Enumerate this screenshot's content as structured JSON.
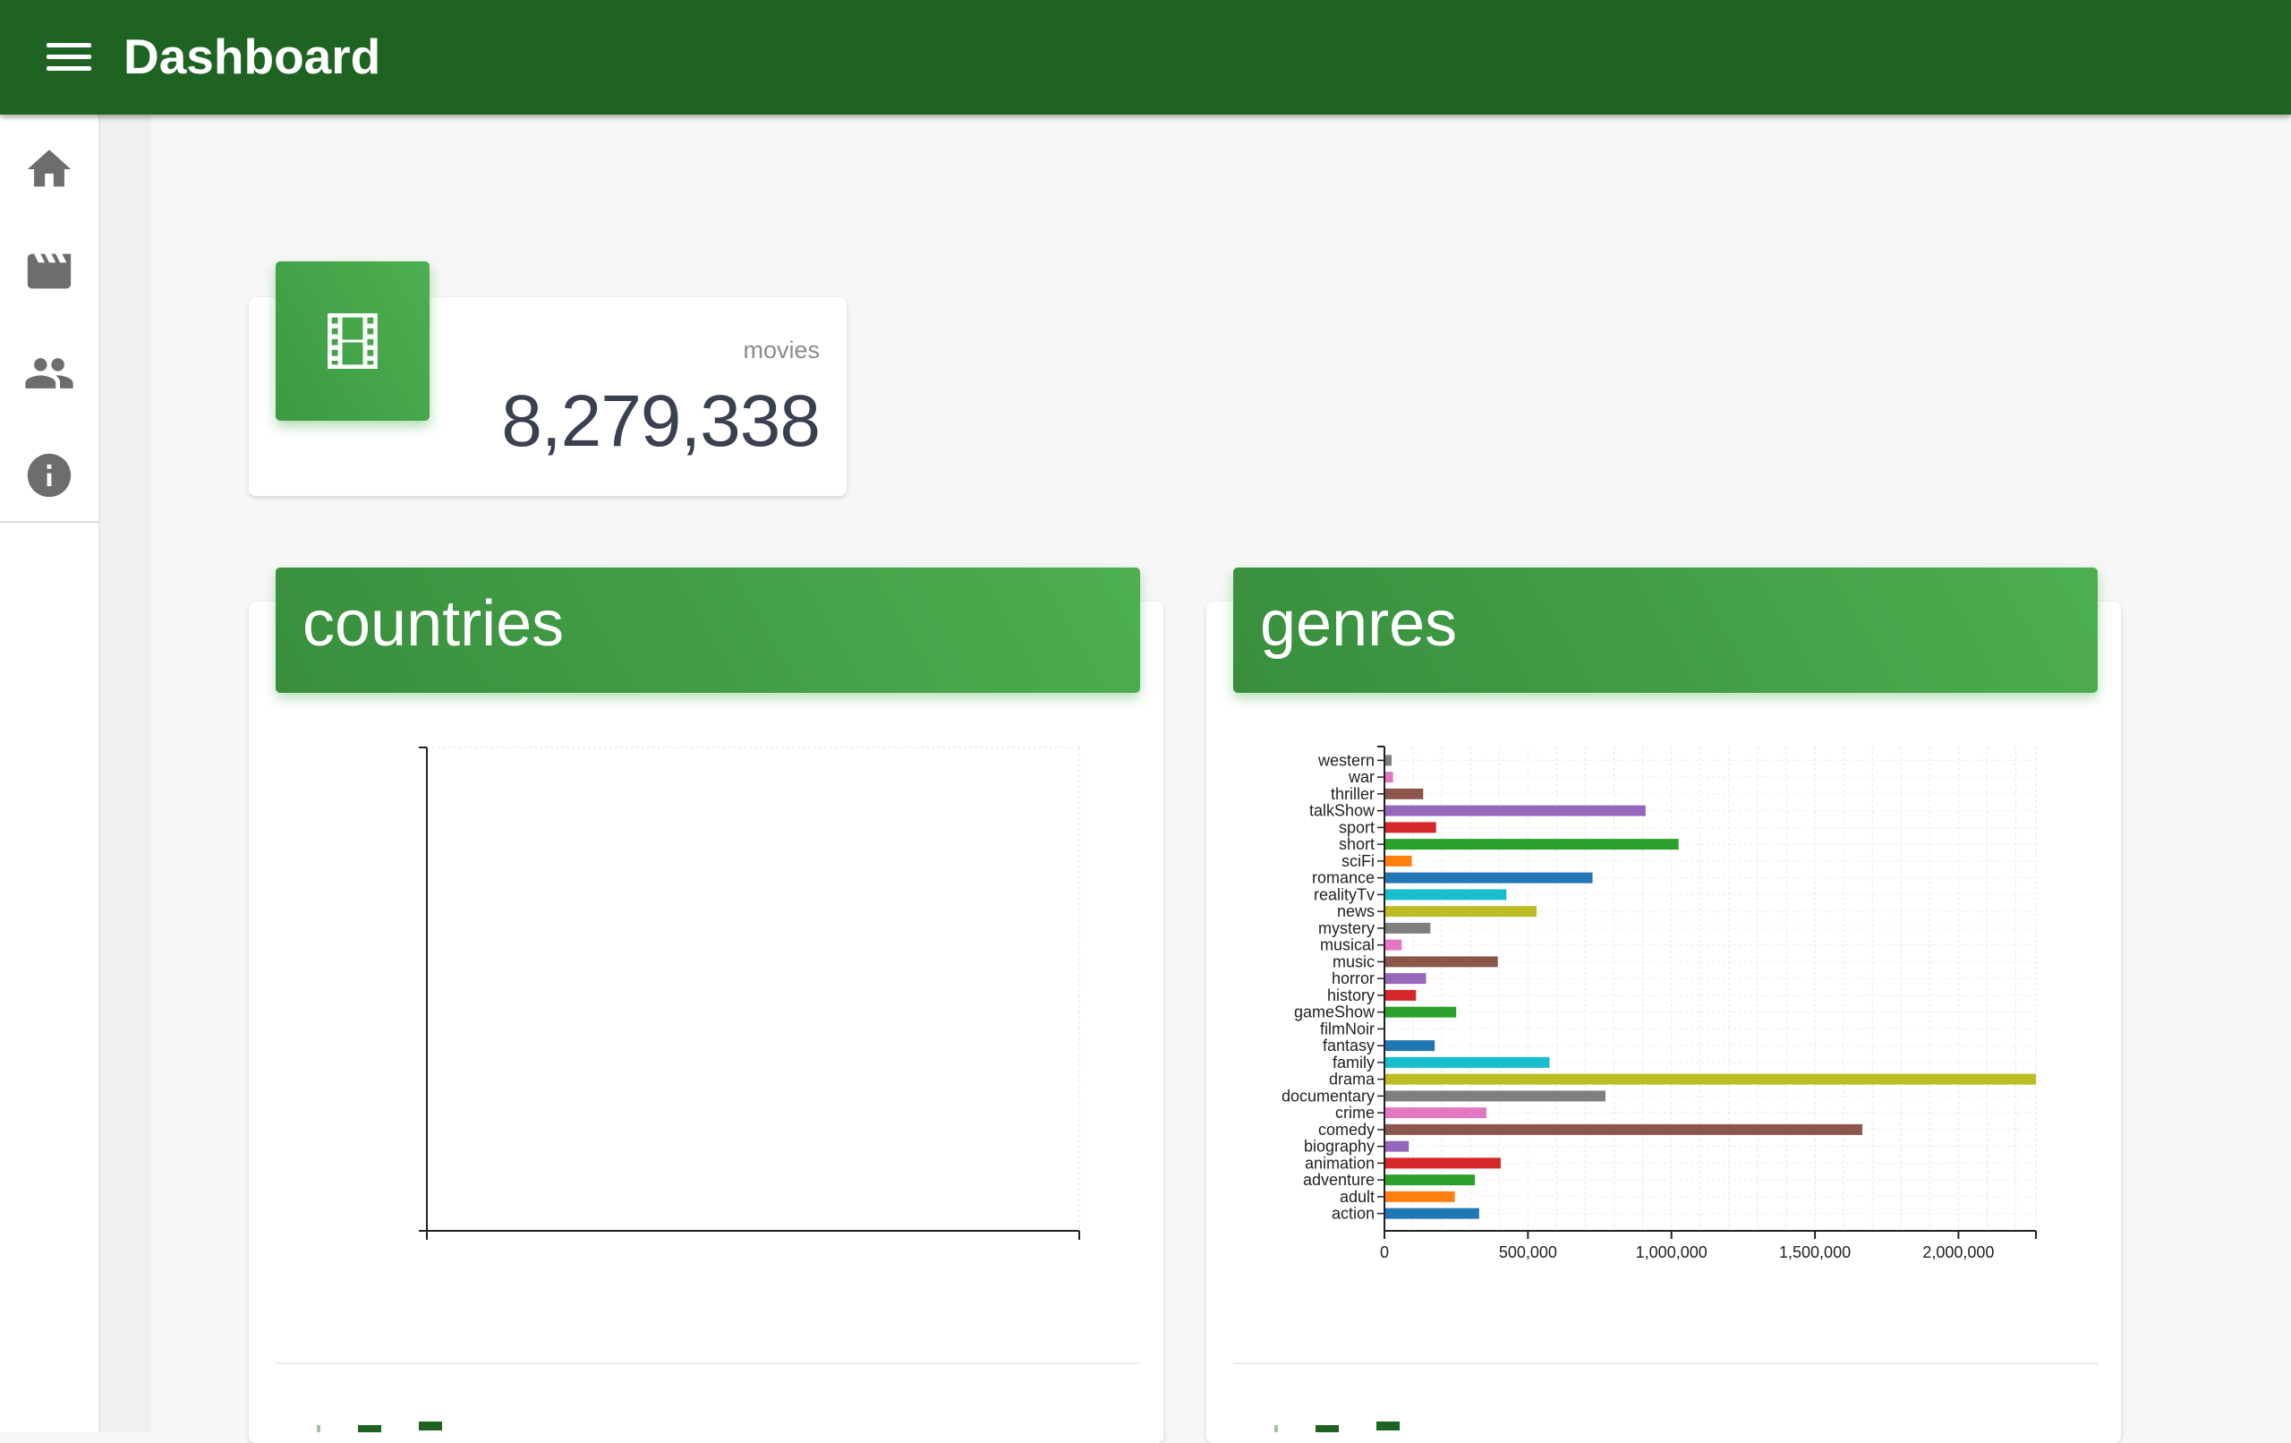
{
  "appbar": {
    "title": "Dashboard",
    "color": "#1f6323"
  },
  "nav": {
    "icons": [
      "home-icon",
      "movie-clapper-icon",
      "people-icon",
      "info-icon"
    ]
  },
  "stat": {
    "label": "movies",
    "value": "8,279,338",
    "icon": "film-icon",
    "accent": "#4caf50"
  },
  "panels": {
    "countries_title": "countries",
    "genres_title": "genres"
  },
  "chart_data": [
    {
      "type": "bar",
      "title": "countries",
      "categories": [],
      "values": []
    },
    {
      "type": "bar",
      "orientation": "horizontal",
      "title": "genres",
      "categories": [
        "western",
        "war",
        "thriller",
        "talkShow",
        "sport",
        "short",
        "sciFi",
        "romance",
        "realityTv",
        "news",
        "mystery",
        "musical",
        "music",
        "horror",
        "history",
        "gameShow",
        "filmNoir",
        "fantasy",
        "family",
        "drama",
        "documentary",
        "crime",
        "comedy",
        "biography",
        "animation",
        "adventure",
        "adult",
        "action"
      ],
      "values": [
        25000,
        30000,
        135000,
        910000,
        180000,
        1025000,
        95000,
        725000,
        425000,
        530000,
        160000,
        60000,
        395000,
        145000,
        110000,
        250000,
        3000,
        175000,
        575000,
        2270000,
        770000,
        355000,
        1665000,
        85000,
        405000,
        315000,
        245000,
        330000
      ],
      "colors": [
        "#7f7f7f",
        "#e377c2",
        "#8c564b",
        "#9467bd",
        "#d62728",
        "#2ca02c",
        "#ff7f0e",
        "#1f77b4",
        "#17becf",
        "#bcbd22",
        "#7f7f7f",
        "#e377c2",
        "#8c564b",
        "#9467bd",
        "#d62728",
        "#2ca02c",
        "#ff7f0e",
        "#1f77b4",
        "#17becf",
        "#bcbd22",
        "#7f7f7f",
        "#e377c2",
        "#8c564b",
        "#9467bd",
        "#d62728",
        "#2ca02c",
        "#ff7f0e",
        "#1f77b4"
      ],
      "xlim": [
        0,
        2270000
      ],
      "xticks": [
        0,
        500000,
        1000000,
        1500000,
        2000000
      ],
      "xtick_labels": [
        "0",
        "500,000",
        "1,000,000",
        "1,500,000",
        "2,000,000"
      ],
      "grid": true
    }
  ]
}
